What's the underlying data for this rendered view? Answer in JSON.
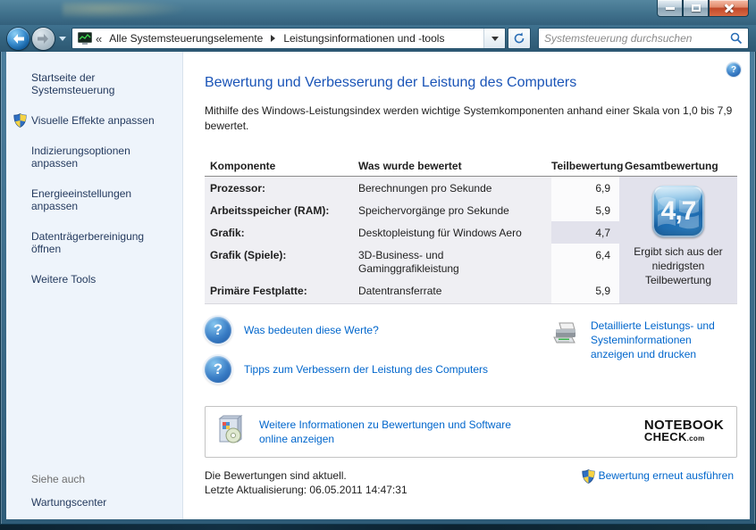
{
  "window": {
    "app": "Windows Explorer - Systemsteuerung",
    "controls": {
      "minimize": "minimize",
      "maximize": "maximize",
      "close": "close"
    }
  },
  "navbar": {
    "breadcrumb_collapsed": "«",
    "breadcrumb": [
      "Alle Systemsteuerungselemente",
      "Leistungsinformationen und -tools"
    ],
    "search_placeholder": "Systemsteuerung durchsuchen"
  },
  "icons": {
    "question_glyph": "?"
  },
  "sidebar": {
    "home_label": "Startseite der Systemsteuerung",
    "tasks": [
      "Visuelle Effekte anpassen",
      "Indizierungsoptionen anpassen",
      "Energieeinstellungen anpassen",
      "Datenträgerbereinigung öffnen",
      "Weitere Tools"
    ],
    "see_also_heading": "Siehe auch",
    "see_also_link": "Wartungscenter"
  },
  "main": {
    "heading": "Bewertung und Verbesserung der Leistung des Computers",
    "intro": "Mithilfe des Windows-Leistungsindex werden wichtige Systemkomponenten anhand einer Skala von 1,0 bis 7,9 bewertet.",
    "table": {
      "headers": [
        "Komponente",
        "Was wurde bewertet",
        "Teilbewertung",
        "Gesamtbewertung"
      ],
      "rows": [
        {
          "component": "Prozessor:",
          "assessed": "Berechnungen pro Sekunde",
          "score": "6,9"
        },
        {
          "component": "Arbeitsspeicher (RAM):",
          "assessed": "Speichervorgänge pro Sekunde",
          "score": "5,9"
        },
        {
          "component": "Grafik:",
          "assessed": "Desktopleistung für Windows Aero",
          "score": "4,7"
        },
        {
          "component": "Grafik (Spiele):",
          "assessed": "3D-Business- und Gaminggrafikleistung",
          "score": "6,4"
        },
        {
          "component": "Primäre Festplatte:",
          "assessed": "Datentransferrate",
          "score": "5,9"
        }
      ]
    },
    "overall": {
      "score": "4,7",
      "caption": "Ergibt sich aus der niedrigsten Teilbewertung"
    },
    "help_links": [
      "Was bedeuten diese Werte?",
      "Tipps zum Verbessern der Leistung des Computers"
    ],
    "print_link": "Detaillierte Leistungs- und Systeminformationen anzeigen und drucken",
    "info_box": {
      "link_text": "Weitere Informationen zu Bewertungen und Software online anzeigen"
    },
    "logo": {
      "line1": "NOTEBOOK",
      "line2": "CHECK",
      "suffix": ".com"
    },
    "status": {
      "line1": "Die Bewertungen sind aktuell.",
      "line2": "Letzte Aktualisierung: 06.05.2011 14:47:31",
      "rerun_label": "Bewertung erneut ausführen"
    }
  },
  "colors": {
    "link_blue": "#0066CC",
    "heading_blue": "#1A54B7",
    "sidebar_link": "#243A5E",
    "titlebar_teal": "#3F7290",
    "close_red": "#C1482A",
    "badge_blue": "#1D6CB2",
    "table_row_bg": "#EFEFF3",
    "overall_col_bg": "#E2E2EC",
    "sidebar_bg": "#EEF4FB"
  }
}
